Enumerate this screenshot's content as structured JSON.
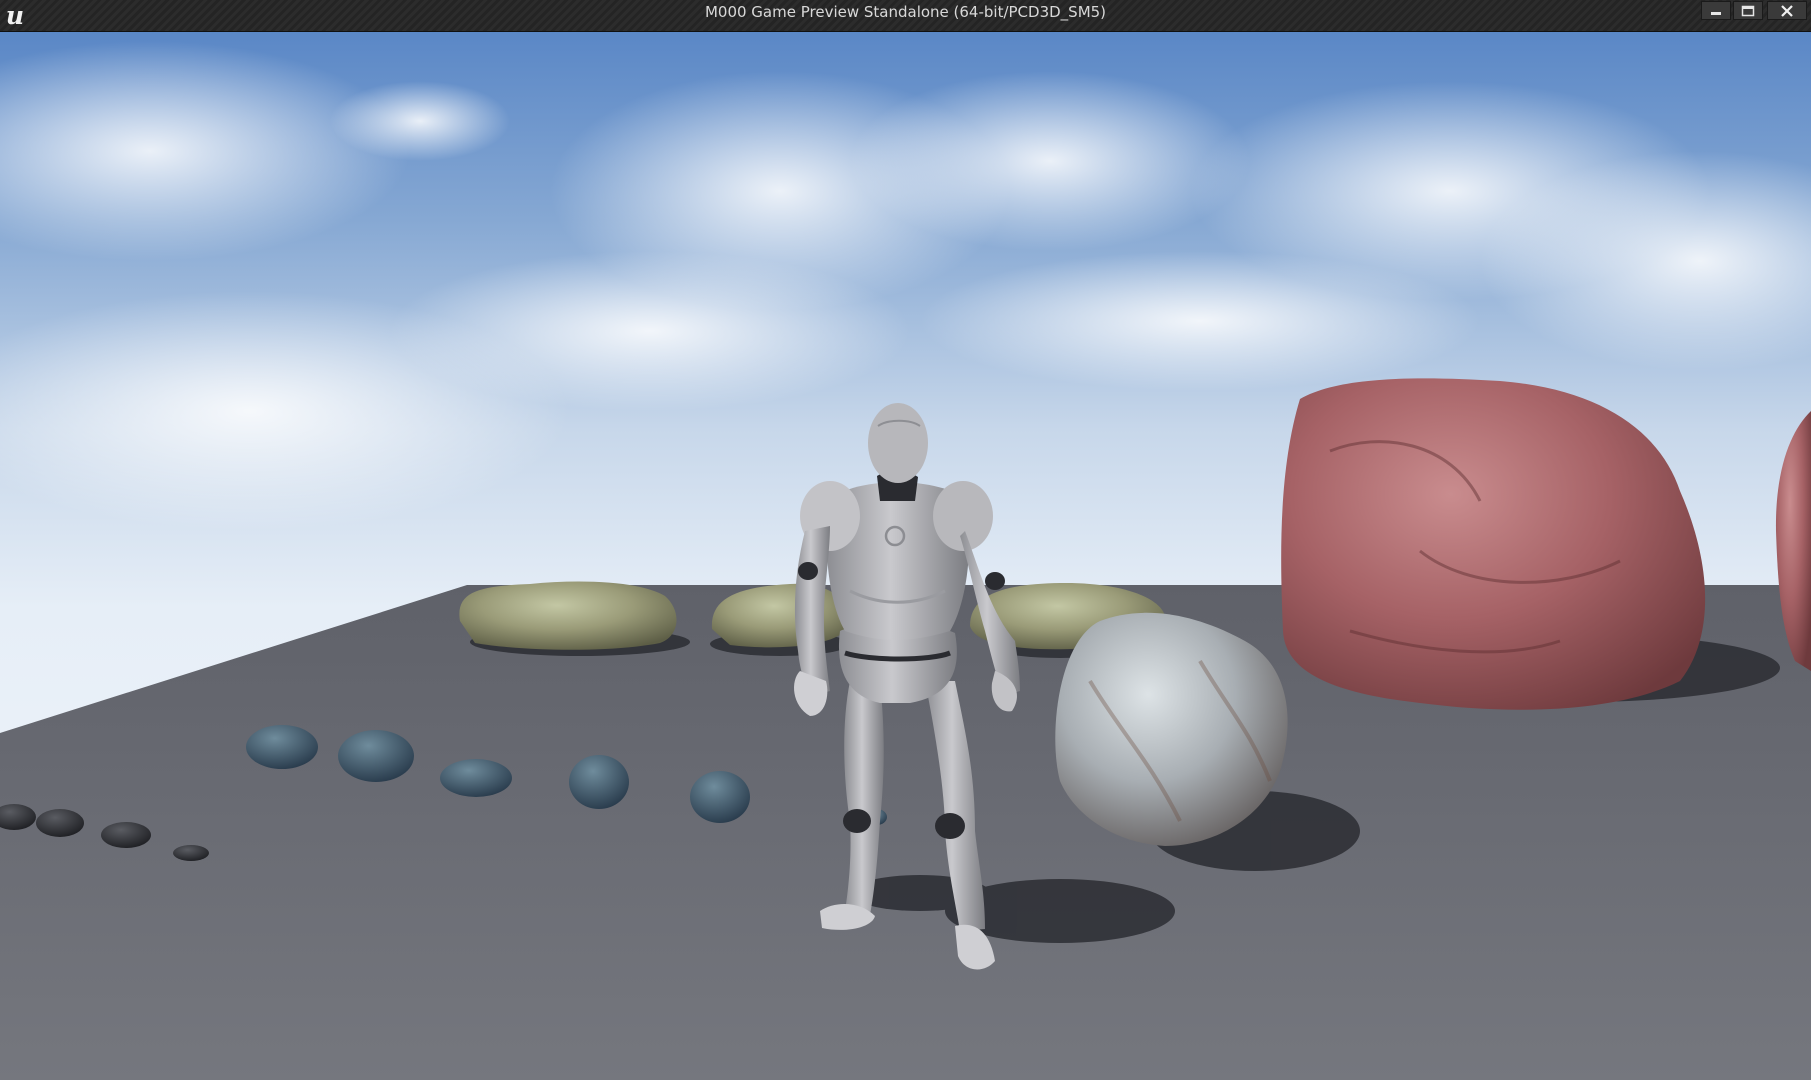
{
  "window": {
    "title": "M000 Game Preview Standalone (64-bit/PCD3D_SM5)",
    "app_logo_icon": "unreal-engine-logo-icon",
    "logo_glyph": "u"
  },
  "controls": {
    "minimize_icon": "minimize-icon",
    "maximize_icon": "maximize-icon",
    "close_icon": "close-icon"
  },
  "colors": {
    "titlebar": "#2a2a2a",
    "sky_top": "#5b86c4",
    "sky_horizon": "#e9f0f8",
    "floor": "#6b6d74",
    "mannequin": "#b9b9bd"
  }
}
